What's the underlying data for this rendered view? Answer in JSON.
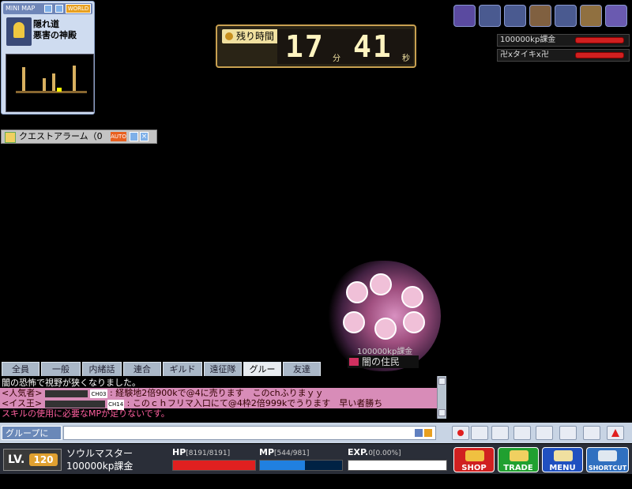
{
  "minimap": {
    "title": "MINI MAP",
    "world_label": "WORLD",
    "map_line1": "隠れ道",
    "map_line2": "悪害の神殿"
  },
  "quest": {
    "label": "クエストアラーム（0",
    "auto_label": "AUTO"
  },
  "timer": {
    "label": "残り時間",
    "minutes": "17",
    "minutes_unit": "分",
    "seconds": "41",
    "seconds_unit": "秒"
  },
  "party": {
    "members": [
      {
        "name": "100000kp課金",
        "hp_fraction": 1.0
      },
      {
        "name": "卍xタイキx卍",
        "hp_fraction": 1.0
      }
    ]
  },
  "top_icons": [
    "drop-icon",
    "weapon-icon",
    "keys-icon",
    "trophy-icon",
    "gear-icon",
    "scroll-icon",
    "star-icon"
  ],
  "character": {
    "name": "100000kp課金",
    "guild": "闇の住民"
  },
  "chat": {
    "tabs": [
      "全員",
      "一般",
      "内緒話",
      "連合",
      "ギルド",
      "遠征隊",
      "グルー",
      "友達"
    ],
    "active_tab": 6,
    "lines": [
      {
        "text": "闇の恐怖で視野が狭くなりました。",
        "style": "plain"
      },
      {
        "text": "<人気者>",
        "channel": "CH03",
        "msg": ": 経験地2倍900kで@4に売ります　このchふりまｙｙ",
        "style": "pink"
      },
      {
        "text": "<イス王>",
        "channel": "CH14",
        "msg": ": このｃｈフリマ入口にて@4枠2倍999kでうります　早い者勝ち",
        "style": "pink"
      },
      {
        "text": "スキルの使用に必要なMPが足りないです。",
        "style": "plain"
      }
    ],
    "input_target": "グループに"
  },
  "status": {
    "lv_label": "LV.",
    "level": "120",
    "job": "ソウルマスター",
    "name": "100000kp課金",
    "hp_label": "HP",
    "hp_text": "[8191/8191]",
    "hp_fraction": 1.0,
    "mp_label": "MP",
    "mp_text": "[544/981]",
    "mp_fraction": 0.55,
    "exp_label": "EXP.",
    "exp_text": "0[0.00%]",
    "exp_fraction": 0.0
  },
  "menu": {
    "shop": "SHOP",
    "trade": "TRADE",
    "menu": "MENU",
    "shortcut": "SHORTCUT"
  },
  "colors": {
    "hp": "#e02020",
    "mp": "#2080e0",
    "exp": "#e0e020",
    "shop": "#d02020",
    "trade": "#20a030",
    "menu_btn": "#2050c0",
    "shortcut_btn": "#3070c0"
  }
}
